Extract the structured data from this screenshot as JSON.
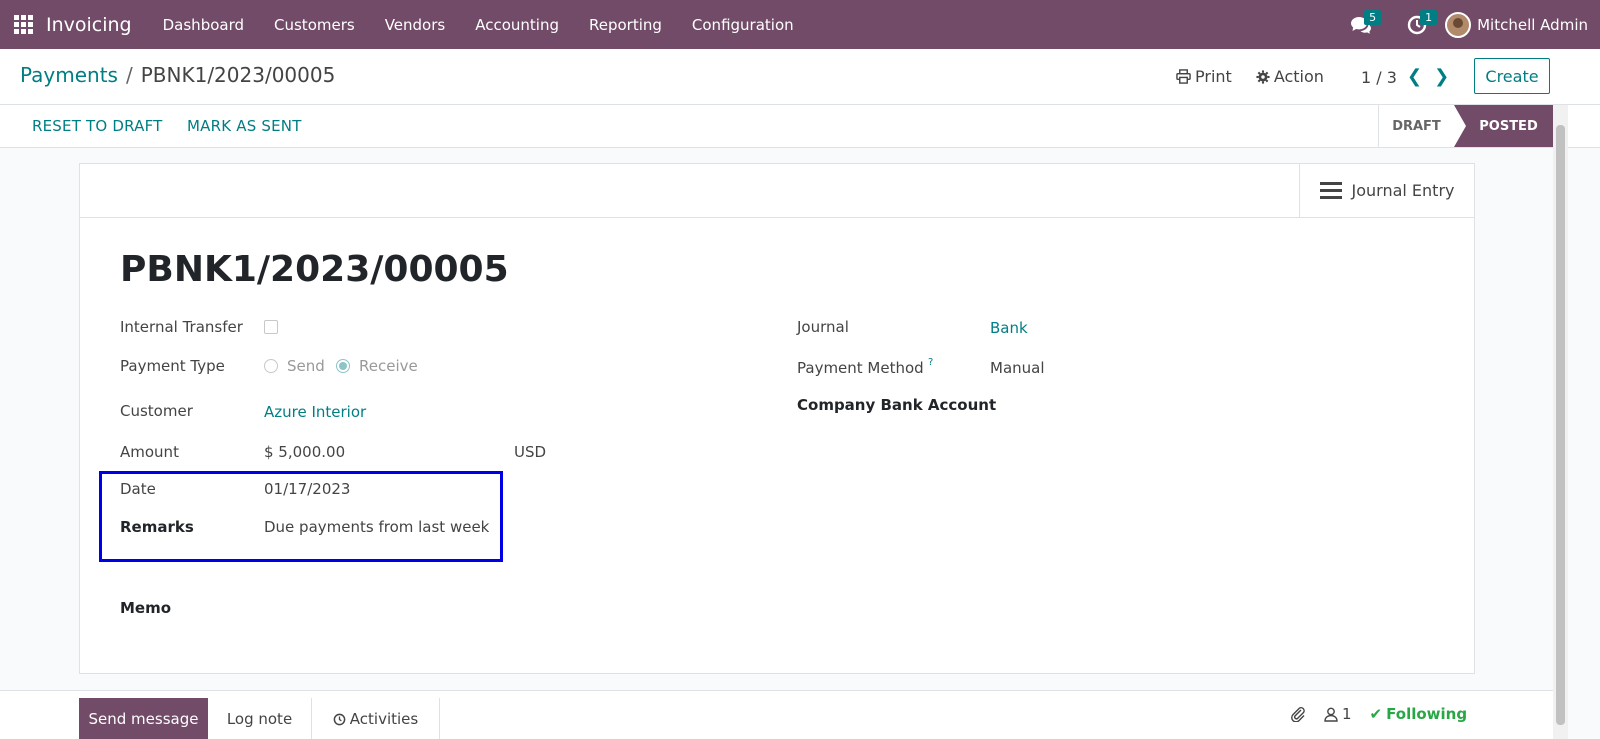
{
  "navbar": {
    "app_name": "Invoicing",
    "menu": [
      "Dashboard",
      "Customers",
      "Vendors",
      "Accounting",
      "Reporting",
      "Configuration"
    ],
    "messages_count": "5",
    "activities_count": "1",
    "user_name": "Mitchell Admin",
    "icons": [
      "apps-grid-icon",
      "chat-icon",
      "clock-icon",
      "avatar"
    ]
  },
  "breadcrumb": {
    "parent": "Payments",
    "separator": "/",
    "current": "PBNK1/2023/00005"
  },
  "control": {
    "print_label": "Print",
    "action_label": "Action",
    "pager": "1 / 3",
    "create_label": "Create"
  },
  "statusbar": {
    "reset_label": "RESET TO DRAFT",
    "mark_sent_label": "MARK AS SENT",
    "stages": [
      "DRAFT",
      "POSTED"
    ],
    "active_stage": "POSTED"
  },
  "sheet": {
    "journal_entry_label": "Journal Entry",
    "title": "PBNK1/2023/00005",
    "left_fields": {
      "internal_transfer_label": "Internal Transfer",
      "payment_type_label": "Payment Type",
      "payment_type_options": [
        "Send",
        "Receive"
      ],
      "payment_type_selected": "Receive",
      "customer_label": "Customer",
      "customer_value": "Azure Interior",
      "amount_label": "Amount",
      "amount_value": "$ 5,000.00",
      "currency_value": "USD",
      "date_label": "Date",
      "date_value": "01/17/2023",
      "remarks_label": "Remarks",
      "remarks_value": "Due payments from last week",
      "memo_label": "Memo"
    },
    "right_fields": {
      "journal_label": "Journal",
      "journal_value": "Bank",
      "payment_method_label": "Payment Method",
      "payment_method_help": "?",
      "payment_method_value": "Manual",
      "company_bank_label": "Company Bank Account"
    }
  },
  "chatter": {
    "send_message_label": "Send message",
    "log_note_label": "Log note",
    "activities_label": "Activities",
    "followers_count": "1",
    "following_label": "Following"
  },
  "colors": {
    "brand": "#714b67",
    "accent": "#017e84",
    "highlight_box": "#0000e6",
    "following": "#28a745"
  }
}
